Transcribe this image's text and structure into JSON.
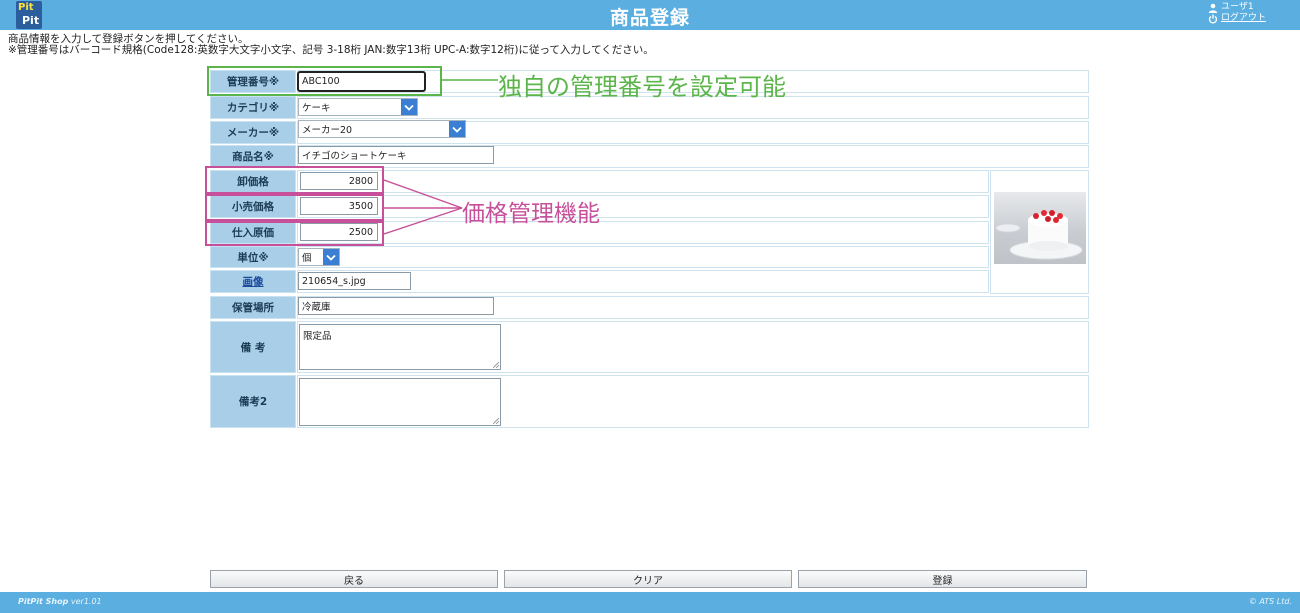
{
  "header": {
    "logo_line1": "Pit",
    "logo_line2": "Pit",
    "title": "商品登録",
    "user_name": "ユーザ1",
    "logout": "ログアウト"
  },
  "instructions": {
    "line1": "商品情報を入力して登録ボタンを押してください。",
    "line2": "※管理番号はバーコード規格(Code128:英数字大文字小文字、記号 3-18桁 JAN:数字13桁 UPC-A:数字12桁)に従って入力してください。"
  },
  "form": {
    "mgmt_no_label": "管理番号※",
    "mgmt_no_value": "ABC100",
    "category_label": "カテゴリ※",
    "category_value": "ケーキ",
    "maker_label": "メーカー※",
    "maker_value": "メーカー20",
    "product_name_label": "商品名※",
    "product_name_value": "イチゴのショートケーキ",
    "wholesale_label": "卸価格",
    "wholesale_value": "2800",
    "retail_label": "小売価格",
    "retail_value": "3500",
    "cost_label": "仕入原価",
    "cost_value": "2500",
    "unit_label": "単位※",
    "unit_value": "個",
    "image_label": "画像",
    "image_value": "210654_s.jpg",
    "storage_label": "保管場所",
    "storage_value": "冷蔵庫",
    "remarks_label": "備 考",
    "remarks_value": "限定品",
    "remarks2_label": "備考2",
    "remarks2_value": ""
  },
  "annotations": {
    "mgmt_feature": "独自の管理番号を設定可能",
    "price_feature": "価格管理機能"
  },
  "buttons": {
    "back": "戻る",
    "clear": "クリア",
    "register": "登録"
  },
  "footer": {
    "app_name": "PitPit Shop",
    "version": "ver1.01",
    "copyright": "© ATS Ltd."
  },
  "colors": {
    "header_bg": "#5aaee0",
    "label_bg": "#a9cfe8",
    "annotation_green": "#5cb54a",
    "annotation_pink": "#c8509a",
    "select_arrow": "#3b7fd4"
  }
}
